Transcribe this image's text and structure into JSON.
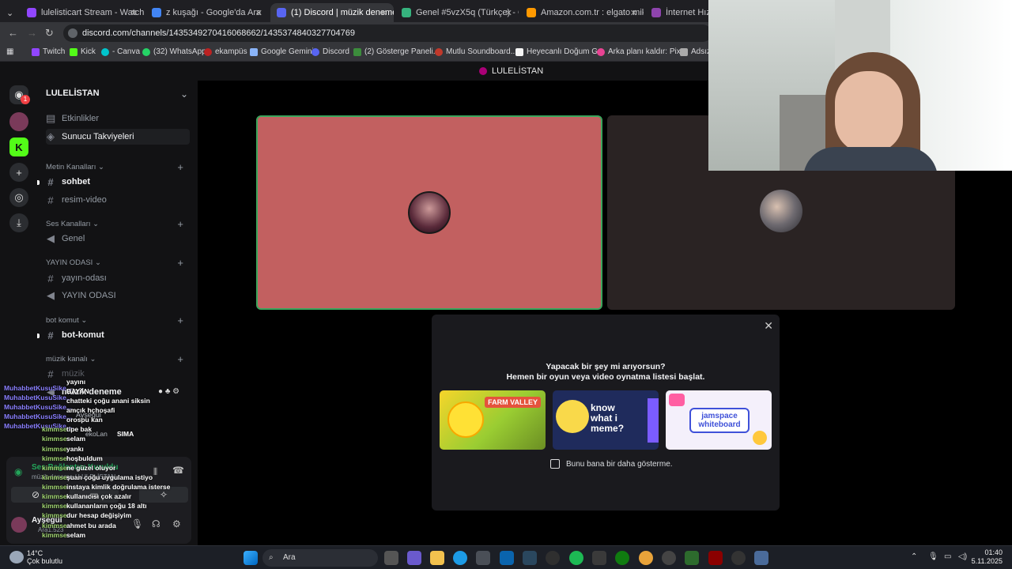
{
  "browser": {
    "tabs": [
      {
        "label": "lulelisticart Stream - Watch Live",
        "active": false,
        "color": "#9146ff"
      },
      {
        "label": "z kuşağı - Google'da Ara",
        "active": false,
        "color": "#4285f4"
      },
      {
        "label": "(1) Discord | müzik deneme",
        "active": true,
        "color": "#5865f2"
      },
      {
        "label": "Genel #5vzX5q (Türkçe) - Gartic",
        "active": false,
        "color": "#36b37e"
      },
      {
        "label": "Amazon.com.tr : elgato mikrofon",
        "active": false,
        "color": "#ff9900"
      },
      {
        "label": "İnternet Hız Testi",
        "active": false,
        "color": "#8e44ad"
      }
    ],
    "url": "discord.com/channels/1435349270416068662/1435374840327704769",
    "bookmarks": [
      "Twitch",
      "Kick",
      "- Canva",
      "(32) WhatsApp",
      "ekampüs",
      "Google Gemini",
      "Discord",
      "(2) Gösterge Paneli...",
      "Mutlu Soundboard...",
      "Heyecanlı Doğum G...",
      "Arka planı kaldır: Pix...",
      "Adsız ta"
    ]
  },
  "discord": {
    "header_title": "LULELİSTAN",
    "server_name": "LULELİSTAN",
    "top_items": [
      "Etkinlikler",
      "Sunucu Takviyeleri"
    ],
    "categories": [
      {
        "name": "Metin Kanalları",
        "channels": [
          "sohbet",
          "resim-video"
        ]
      },
      {
        "name": "Ses Kanalları",
        "channels": [
          "Genel"
        ]
      },
      {
        "name": "YAYIN ODASI",
        "channels": [
          "yayın-odası",
          "YAYIN ODASI"
        ]
      },
      {
        "name": "bot komut",
        "channels": [
          "bot-komut"
        ]
      },
      {
        "name": "müzik kanalı",
        "channels": [
          "müzik",
          "müzik deneme"
        ]
      }
    ],
    "guild_badge": "1",
    "voice_status": "Ses Bağlantısı Kuruldu",
    "voice_sub": "müzik deneme / LULELİSTAN",
    "user": {
      "name": "Ayşegül",
      "status": "Ara1.523"
    },
    "voice_members": [
      "Ayşegül",
      "ekoLan",
      "SIMA"
    ],
    "modal": {
      "line1": "Yapacak bir şey mi arıyorsun?",
      "line2": "Hemen bir oyun veya video oynatma listesi başlat.",
      "activities": [
        "FARM VALLEY",
        "know what i meme?",
        "jamspace whiteboard"
      ],
      "checkbox_label": "Bunu bana bir daha gösterme."
    }
  },
  "chat_overlay": [
    {
      "user": "MuhabbetKusuSike...",
      "msg": "yayını"
    },
    {
      "user": "MuhabbetKusuSike...",
      "msg": "BAYAN"
    },
    {
      "user": "MuhabbetKusuSike...",
      "msg": "chatteki çoğu anani siksin"
    },
    {
      "user": "MuhabbetKusuSike...",
      "msg": "amcık hçhoşafi"
    },
    {
      "user": "MuhabbetKusuSike...",
      "msg": "orospu kan"
    },
    {
      "user": "kimmse",
      "msg": "tipe bak"
    },
    {
      "user": "kimmse",
      "msg": "selam"
    },
    {
      "user": "kimmse",
      "msg": "yankı"
    },
    {
      "user": "kimmse",
      "msg": "hoşbuldum"
    },
    {
      "user": "kimmse",
      "msg": "ne güzel oluyor"
    },
    {
      "user": "kimmse",
      "msg": "şuan çoğu uygulama istiyo"
    },
    {
      "user": "kimmse",
      "msg": "instaya kimlik doğrulama isterse"
    },
    {
      "user": "kimmse",
      "msg": "kullanıcısı çok azalır"
    },
    {
      "user": "kimmse",
      "msg": "kullananların çoğu 18 altı"
    },
    {
      "user": "kimmse",
      "msg": "dur hesap değişiyim"
    },
    {
      "user": "kimmse",
      "msg": "ahmet bu arada"
    },
    {
      "user": "kimmse",
      "msg": "selam"
    }
  ],
  "taskbar": {
    "weather_temp": "14°C",
    "weather_desc": "Çok bulutlu",
    "search_placeholder": "Ara",
    "time": "01:40",
    "date": "5.11.2025"
  }
}
